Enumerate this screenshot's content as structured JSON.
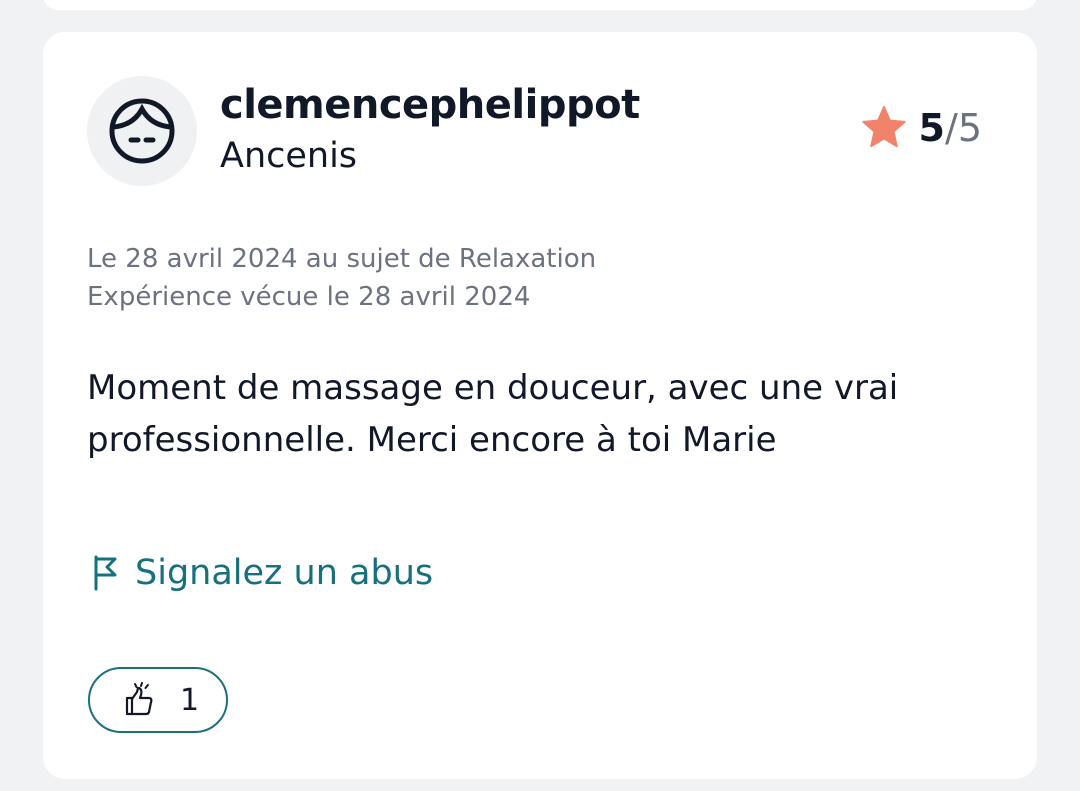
{
  "review": {
    "username": "clemencephelippot",
    "city": "Ancenis",
    "rating": {
      "value": "5",
      "separator": "/",
      "max": "5"
    },
    "meta_line1": "Le 28 avril 2024 au sujet de Relaxation",
    "meta_line2": "Expérience vécue le 28 avril 2024",
    "comment": "Moment de massage en douceur, avec une vrai professionnelle. Merci encore à toi Marie",
    "report_label": "Signalez un abus",
    "like_count": "1"
  },
  "icons": {
    "avatar": "face-icon",
    "rating": "star-icon",
    "report": "flag-icon",
    "like": "thumbs-up-icon"
  },
  "colors": {
    "star": "#f3826a",
    "link": "#17707e",
    "button_border": "#1e6f7e",
    "text": "#111827",
    "muted": "#6b7280",
    "background": "#f1f2f4"
  }
}
